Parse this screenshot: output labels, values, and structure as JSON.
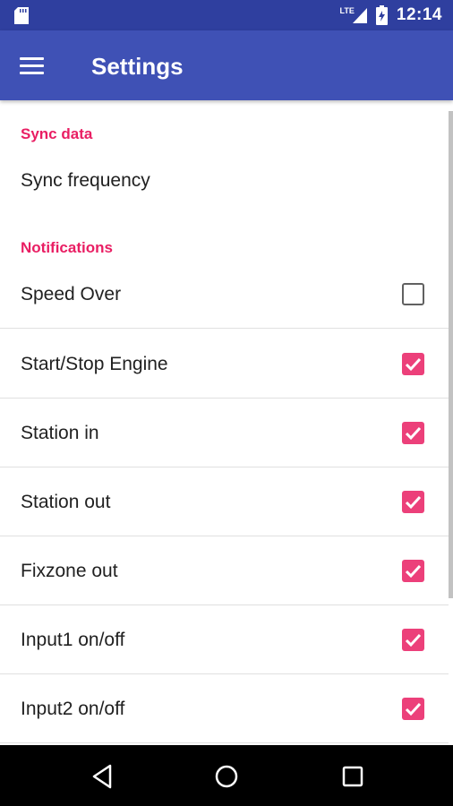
{
  "status_bar": {
    "network": "LTE",
    "time": "12:14"
  },
  "app_bar": {
    "title": "Settings",
    "menu_icon": "hamburger-menu-icon"
  },
  "sections": {
    "sync": {
      "header": "Sync data",
      "sync_frequency_label": "Sync frequency"
    },
    "notifications": {
      "header": "Notifications",
      "items": [
        {
          "label": "Speed Over",
          "checked": false
        },
        {
          "label": "Start/Stop Engine",
          "checked": true
        },
        {
          "label": "Station in",
          "checked": true
        },
        {
          "label": "Station out",
          "checked": true
        },
        {
          "label": "Fixzone out",
          "checked": true
        },
        {
          "label": "Input1 on/off",
          "checked": true
        },
        {
          "label": "Input2 on/off",
          "checked": true
        }
      ]
    }
  },
  "colors": {
    "status_bar": "#2f3f9f",
    "app_bar": "#3f51b5",
    "accent": "#e91e63",
    "checkbox_checked": "#ec407a",
    "nav_bar": "#000000"
  },
  "nav_bar": {
    "icons": [
      "back-icon",
      "home-icon",
      "recents-icon"
    ]
  }
}
